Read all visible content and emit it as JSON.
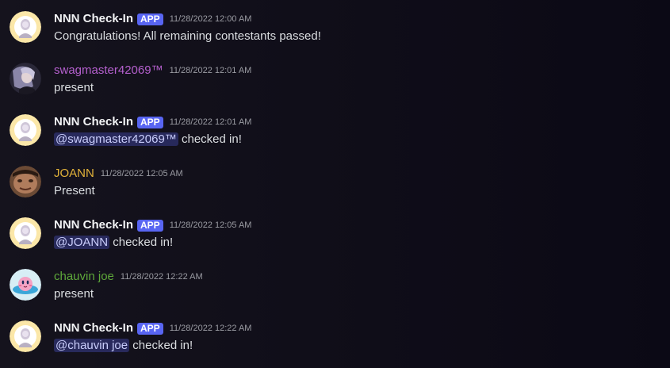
{
  "messages": [
    {
      "author": "NNN Check-In",
      "tag": "APP",
      "timestamp": "11/28/2022 12:00 AM",
      "text": "Congratulations! All remaining contestants passed!"
    },
    {
      "author": "swagmaster42069™",
      "timestamp": "11/28/2022 12:01 AM",
      "text": "present"
    },
    {
      "author": "NNN Check-In",
      "tag": "APP",
      "timestamp": "11/28/2022 12:01 AM",
      "mention": "@swagmaster42069™",
      "text": " checked in!"
    },
    {
      "author": "JOANN",
      "timestamp": "11/28/2022 12:05 AM",
      "text": "Present"
    },
    {
      "author": "NNN Check-In",
      "tag": "APP",
      "timestamp": "11/28/2022 12:05 AM",
      "mention": "@JOANN",
      "text": " checked in!"
    },
    {
      "author": "chauvin joe",
      "timestamp": "11/28/2022 12:22 AM",
      "text": "present"
    },
    {
      "author": "NNN Check-In",
      "tag": "APP",
      "timestamp": "11/28/2022 12:22 AM",
      "mention": "@chauvin joe",
      "text": " checked in!"
    }
  ],
  "colors": {
    "bot_name": "#f2f3f5",
    "swagmaster_name": "#b560ce",
    "joann_name": "#e3b33a",
    "chauvin_name": "#5ea83a",
    "app_tag": "#5865f2",
    "mention_bg": "#353a6e"
  },
  "icons": {
    "bot_avatar": "nnn-bot-avatar-icon",
    "swag_avatar": "swagmaster-avatar-icon",
    "joann_avatar": "joann-avatar-icon",
    "chauvin_avatar": "kirby-avatar-icon"
  }
}
